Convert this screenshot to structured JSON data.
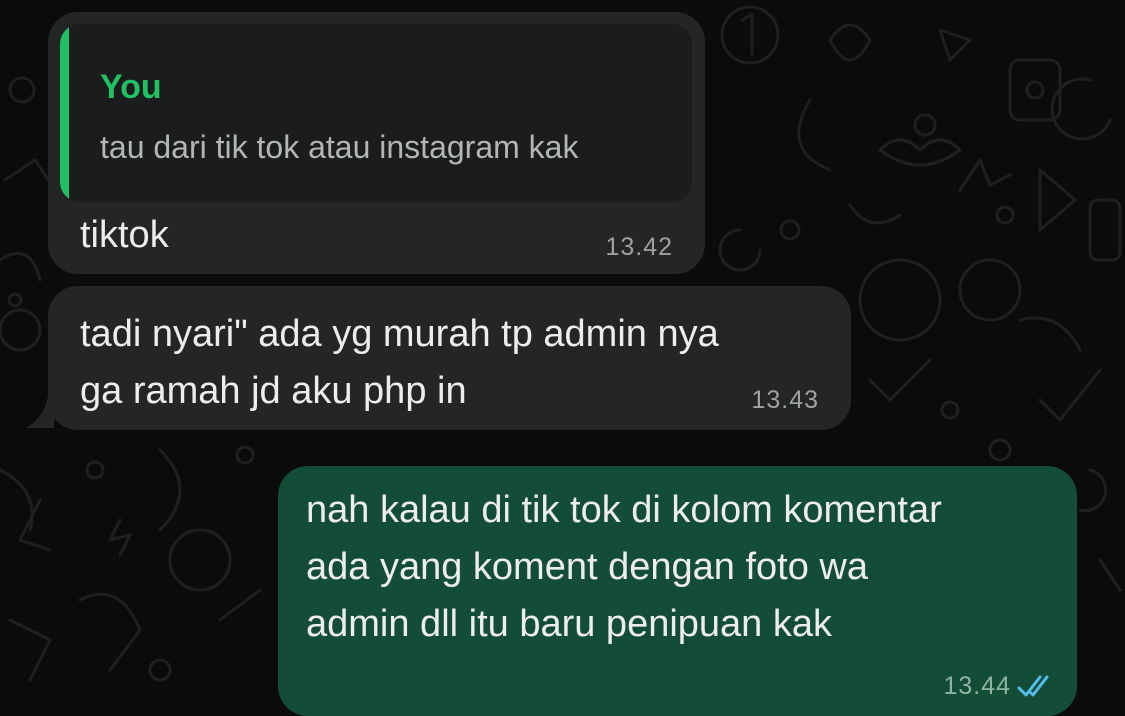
{
  "colors": {
    "background": "#0b0b0b",
    "incoming_bubble": "#242626",
    "outgoing_bubble": "#144d37",
    "quote_accent": "#21c063",
    "read_ticks": "#53bdeb"
  },
  "messages": [
    {
      "direction": "incoming",
      "reply_to": {
        "sender": "You",
        "text": "tau dari tik tok atau instagram kak"
      },
      "lines": [
        "tiktok"
      ],
      "time": "13.42"
    },
    {
      "direction": "incoming",
      "lines": [
        "tadi nyari\" ada yg murah tp admin nya",
        "ga ramah jd aku php in"
      ],
      "time": "13.43"
    },
    {
      "direction": "outgoing",
      "lines": [
        "nah kalau di tik tok di kolom komentar",
        "ada yang koment dengan foto wa",
        "admin dll itu baru penipuan kak"
      ],
      "time": "13.44",
      "status_icon": "read-double-check-icon"
    }
  ]
}
